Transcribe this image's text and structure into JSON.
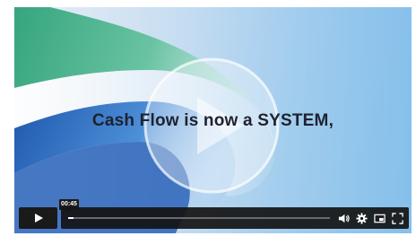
{
  "video": {
    "caption": "Cash Flow is now a SYSTEM,",
    "timestamp_tooltip": "00:45",
    "progress_fraction": 0.02
  },
  "controls": {
    "play_icon": "play-icon",
    "volume_icon": "volume-icon",
    "settings_icon": "gear-icon",
    "pip_icon": "picture-in-picture-icon",
    "fullscreen_icon": "fullscreen-icon"
  },
  "colors": {
    "bar": "#141414",
    "accent_green": "#3fae8c",
    "accent_blue": "#2f6fc4"
  }
}
